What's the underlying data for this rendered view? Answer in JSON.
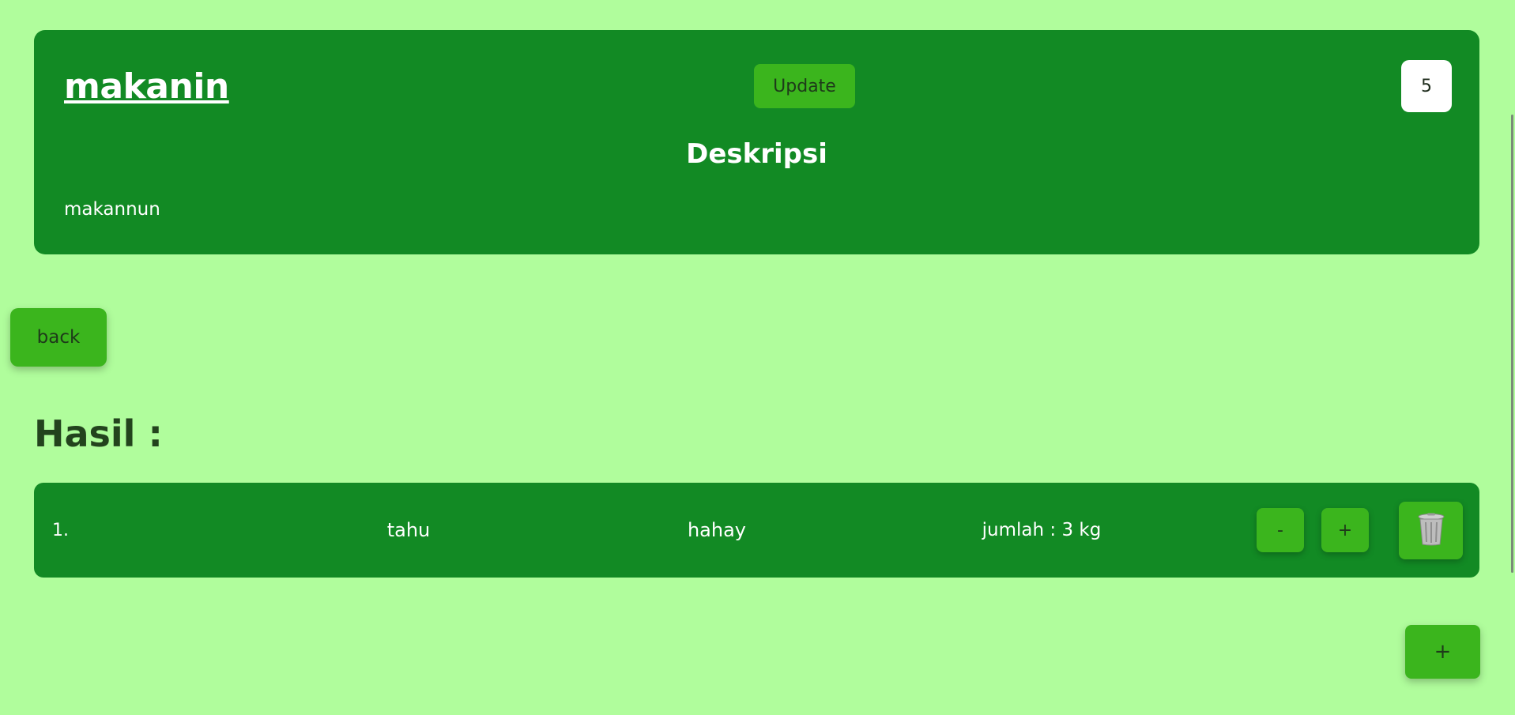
{
  "header": {
    "title": "makanin",
    "update_label": "Update",
    "count": "5",
    "desc_heading": "Deskripsi",
    "desc_text": "makannun"
  },
  "nav": {
    "back_label": "back"
  },
  "results": {
    "heading": "Hasil :",
    "rows": [
      {
        "number": "1.",
        "name": "tahu",
        "description": "hahay",
        "quantity": "jumlah : 3 kg",
        "decrement_label": "-",
        "increment_label": "+"
      }
    ],
    "add_label": "+"
  },
  "icons": {
    "delete": "trash-icon"
  },
  "colors": {
    "background": "#b0fd9c",
    "card": "#128a24",
    "button": "#3bb51d"
  }
}
